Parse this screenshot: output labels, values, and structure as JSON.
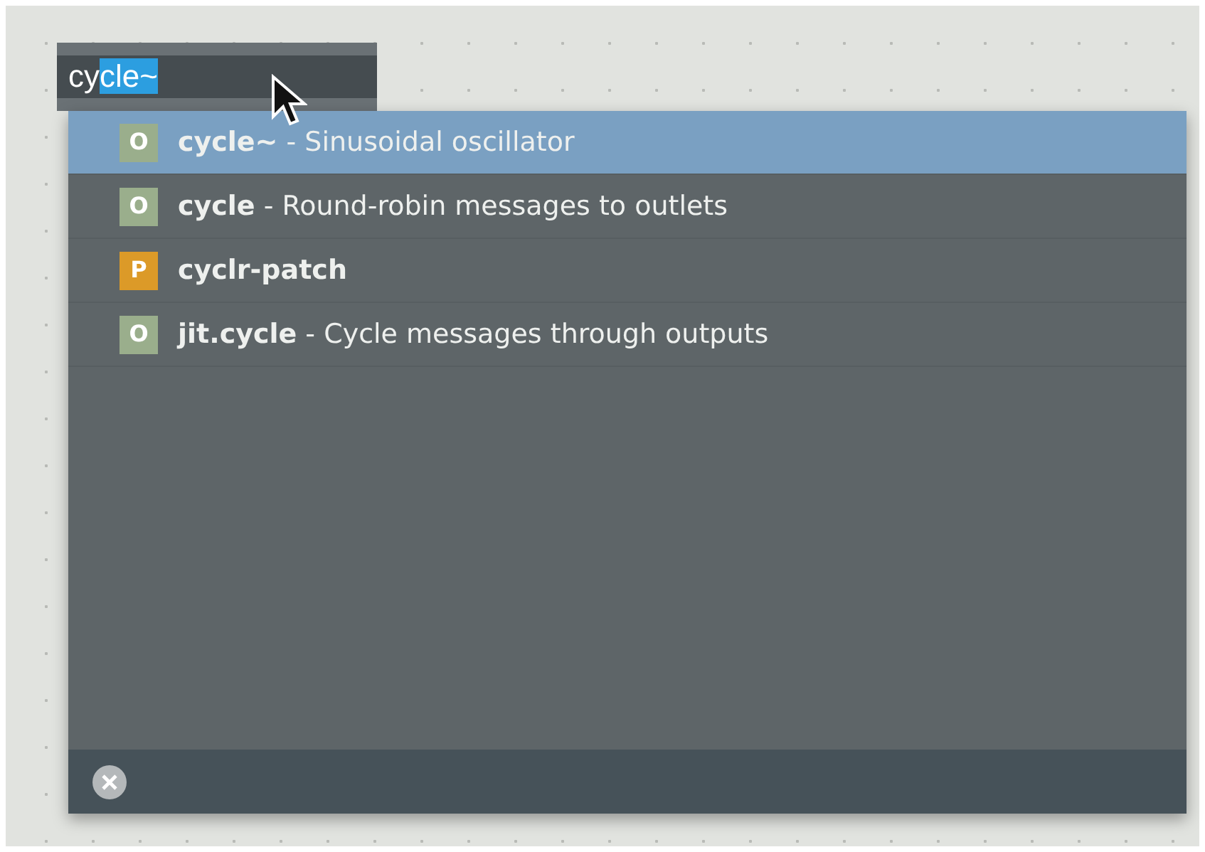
{
  "object_box": {
    "text": "cy",
    "selected_text": "cle~"
  },
  "suggestions": [
    {
      "badge": "O",
      "color": "#9aae8c",
      "name": "cycle~",
      "description": " - Sinusoidal oscillator",
      "selected": true
    },
    {
      "badge": "O",
      "color": "#9aae8c",
      "name": "cycle",
      "description": " - Round-robin messages to outlets",
      "selected": false
    },
    {
      "badge": "P",
      "color": "#dc9a28",
      "name": "cyclr-patch",
      "selected": false
    },
    {
      "badge": "O",
      "color": "#9aae8c",
      "name": "jit.cycle",
      "description": " - Cycle messages through outputs",
      "selected": false
    }
  ]
}
